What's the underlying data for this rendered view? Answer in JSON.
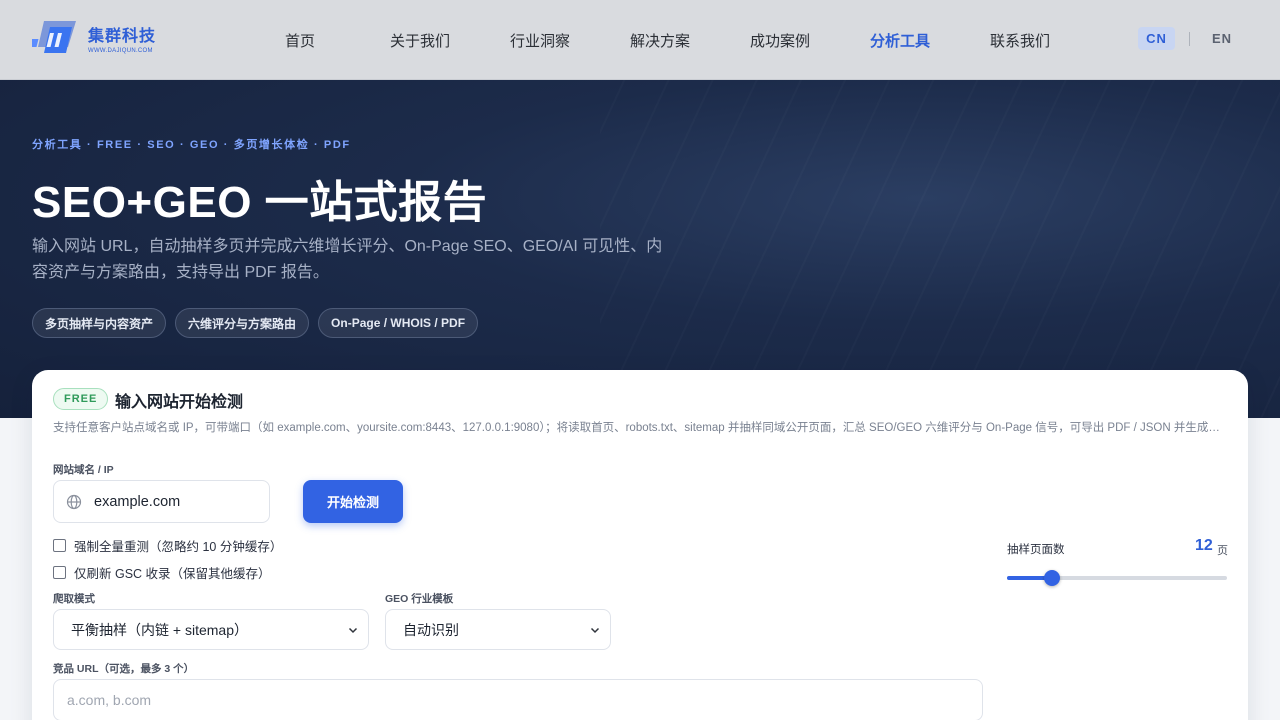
{
  "brand": {
    "name": "集群科技",
    "domain": "WWW.DAJIQUN.COM",
    "color": "#2f5fd6"
  },
  "nav": {
    "items": [
      {
        "label": "首页",
        "active": false
      },
      {
        "label": "关于我们",
        "active": false
      },
      {
        "label": "行业洞察",
        "active": false
      },
      {
        "label": "解决方案",
        "active": false
      },
      {
        "label": "成功案例",
        "active": false
      },
      {
        "label": "分析工具",
        "active": true
      },
      {
        "label": "联系我们",
        "active": false
      }
    ],
    "lang": {
      "cn": "CN",
      "en": "EN",
      "selected": "CN"
    }
  },
  "hero": {
    "eyebrow": "分析工具 · FREE · SEO · GEO · 多页增长体检 · PDF",
    "title": "SEO+GEO 一站式报告",
    "description": "输入网站 URL，自动抽样多页并完成六维增长评分、On-Page SEO、GEO/AI 可见性、内容资产与方案路由，支持导出 PDF 报告。",
    "chips": [
      "多页抽样与内容资产",
      "六维评分与方案路由",
      "On-Page / WHOIS / PDF"
    ]
  },
  "form": {
    "badge": "FREE",
    "title": "输入网站开始检测",
    "description": "支持任意客户站点域名或 IP，可带端口（如 example.com、yoursite.com:8443、127.0.0.1:9080）；将读取首页、robots.txt、sitemap 并抽样同域公开页面，汇总 SEO/GEO 六维评分与 On-Page 信号，可导出 PDF / JSON 并生成分享链...",
    "url_label": "网站域名 / IP",
    "url_value": "example.com",
    "start_button": "开始检测",
    "force_full": {
      "label": "强制全量重测（忽略约 10 分钟缓存）",
      "checked": false
    },
    "gsc_only": {
      "label": "仅刷新 GSC 收录（保留其他缓存）",
      "checked": false
    },
    "crawl_mode_label": "爬取模式",
    "crawl_mode_value": "平衡抽样（内链 + sitemap）",
    "geo_template_label": "GEO 行业模板",
    "geo_template_value": "自动识别",
    "competitor_label": "竞品 URL（可选，最多 3 个）",
    "competitor_placeholder": "a.com, b.com",
    "pages_label": "抽样页面数",
    "pages_value": "12",
    "pages_unit": "页",
    "pages_fraction": 0.18
  }
}
